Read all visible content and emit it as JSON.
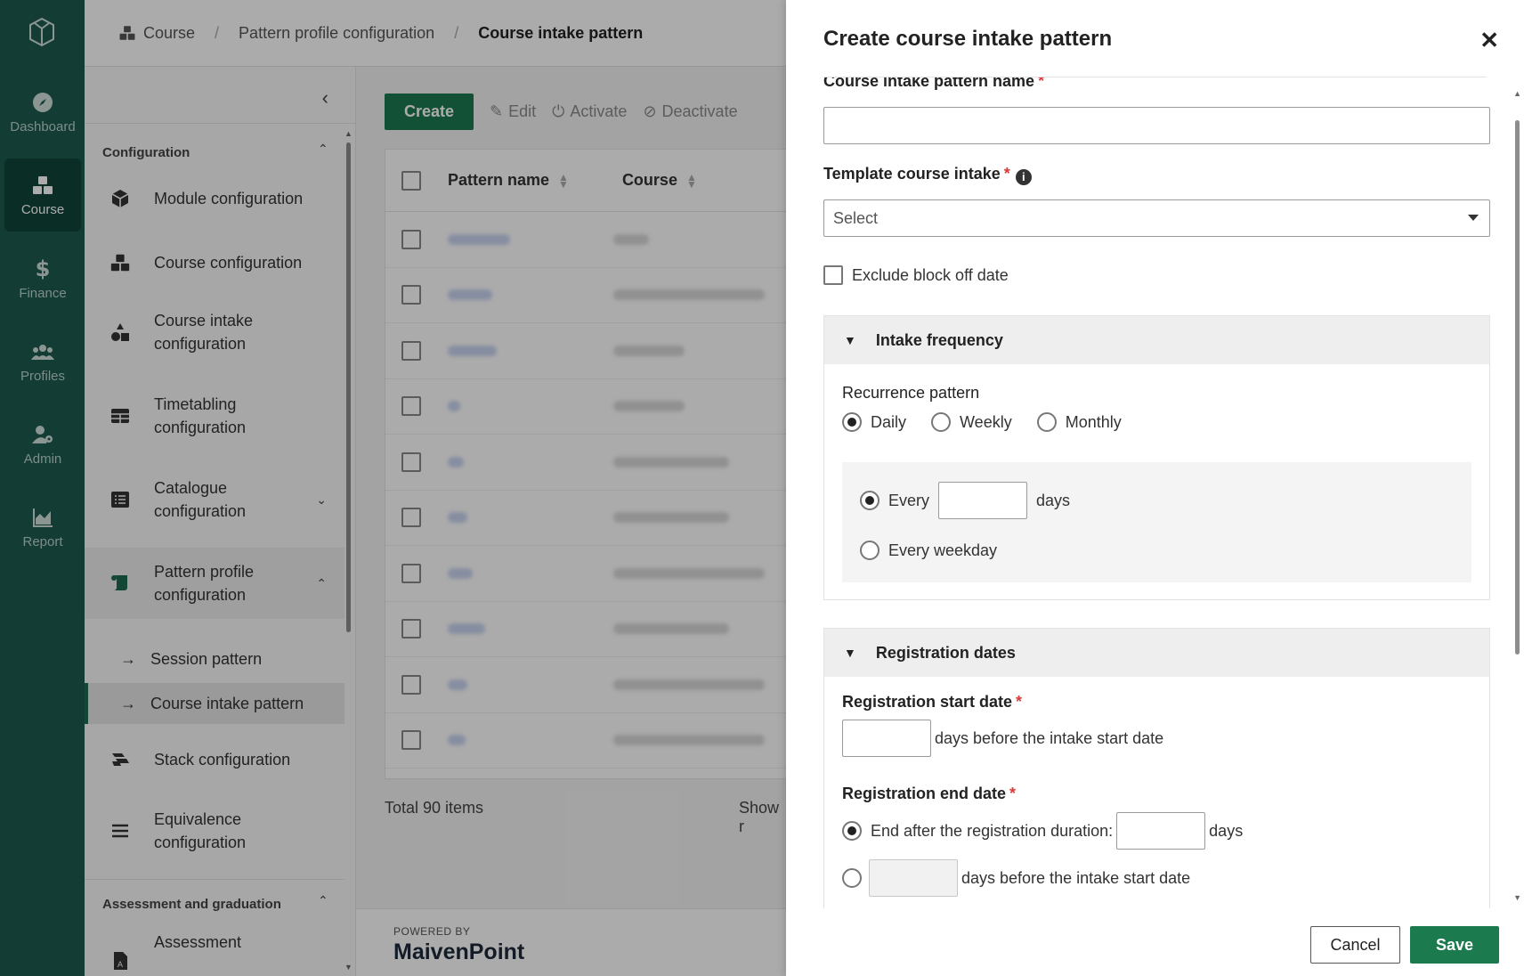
{
  "rail": {
    "items": [
      {
        "label": "Dashboard",
        "icon": "compass-icon"
      },
      {
        "label": "Course",
        "icon": "cubes-icon"
      },
      {
        "label": "Finance",
        "icon": "dollar-icon"
      },
      {
        "label": "Profiles",
        "icon": "users-icon"
      },
      {
        "label": "Admin",
        "icon": "user-gear-icon"
      },
      {
        "label": "Report",
        "icon": "chart-area-icon"
      }
    ],
    "active": "Course",
    "color": "#1c5a4e"
  },
  "breadcrumb": {
    "items": [
      "Course",
      "Pattern profile configuration",
      "Course intake pattern"
    ]
  },
  "subnav": {
    "sections": {
      "configuration": "Configuration",
      "assessment": "Assessment and graduation"
    },
    "items": [
      {
        "label": "Module configuration",
        "icon": "cube-icon"
      },
      {
        "label": "Course configuration",
        "icon": "cubes-icon"
      },
      {
        "label": "Course intake\nconfiguration",
        "icon": "shapes-icon"
      },
      {
        "label": "Timetabling\nconfiguration",
        "icon": "table-icon"
      },
      {
        "label": "Catalogue\nconfiguration",
        "icon": "list-icon"
      },
      {
        "label": "Pattern profile\nconfiguration",
        "icon": "scroll-icon"
      },
      {
        "label": "Stack configuration",
        "icon": "stack-icon"
      },
      {
        "label": "Equivalence\nconfiguration",
        "icon": "bars-icon"
      },
      {
        "label": "Assessment",
        "icon": "file-a-icon"
      }
    ],
    "subitems": [
      "Session pattern",
      "Course intake pattern"
    ],
    "active_subitem": "Course intake pattern"
  },
  "toolbar": {
    "create": "Create",
    "edit": "Edit",
    "activate": "Activate",
    "deactivate": "Deactivate"
  },
  "table": {
    "columns": [
      "Pattern name",
      "Course"
    ],
    "row_count_visible": 10,
    "total": "Total 90 items",
    "show": "Show r"
  },
  "footer": {
    "powered": "POWERED BY",
    "brand": "MaivenPoint"
  },
  "panel": {
    "title": "Create course intake pattern",
    "fields": {
      "name_label": "Course intake pattern name",
      "name_value": "",
      "template_label": "Template course intake",
      "template_value": "Select",
      "exclude_label": "Exclude block off date"
    },
    "intake_frequency": {
      "title": "Intake frequency",
      "recurrence_label": "Recurrence pattern",
      "options": [
        "Daily",
        "Weekly",
        "Monthly"
      ],
      "selected": "Daily",
      "every_label": "Every",
      "every_unit": "days",
      "every_value": "",
      "weekday_label": "Every weekday"
    },
    "registration": {
      "title": "Registration dates",
      "start_label": "Registration start date",
      "start_suffix": "days before the intake start date",
      "end_label": "Registration end date",
      "end_option1": "End after the registration duration:",
      "end_option1_unit": "days",
      "end_option2_suffix": "days before the intake start date"
    },
    "buttons": {
      "cancel": "Cancel",
      "save": "Save"
    },
    "accent": "#1c7a4f"
  }
}
